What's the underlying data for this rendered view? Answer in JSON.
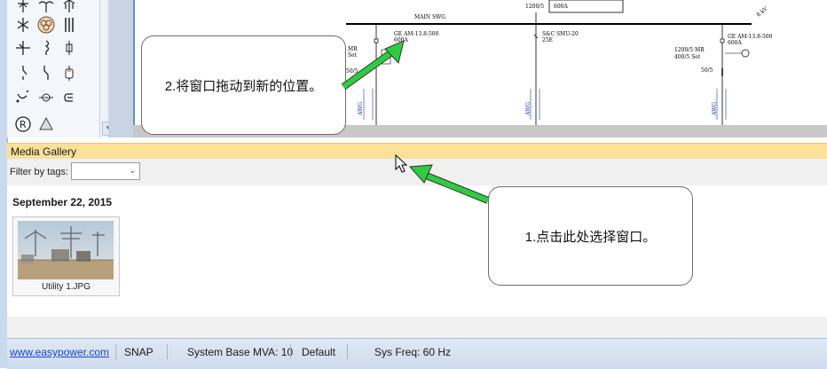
{
  "palette": {
    "symbols": [
      "generator-symbol",
      "motor-symbol",
      "bus-symbol",
      "breaker-symbol",
      "fuse-symbol",
      "relay-symbol",
      "switch-symbol",
      "cable-symbol",
      "capacitor-symbol",
      "transformer-symbol",
      "meter-symbol",
      "load-symbol",
      "r-symbol",
      "triangle-symbol"
    ],
    "r_label": "R"
  },
  "diagram": {
    "bus_label": "MAIN SWG",
    "ct_top": "1200/5",
    "top_rating": "600A",
    "left_breaker": "GE AM-13.8-500",
    "left_rating": "600A",
    "left_relay_1": "MR",
    "left_relay_2": "Set",
    "left_ct": "50/5",
    "center_breaker": "S&C SMU-20",
    "center_rating": "25E",
    "right_breaker": "GE AM-13.8-500",
    "right_rating": "600A",
    "right_relay_1": "1200/5 MR",
    "right_relay_2": "400/5 Set",
    "right_ct": "50/5",
    "corner_label": "8 kV",
    "cable_label": "AWG"
  },
  "callouts": {
    "step2": "2.将窗口拖动到新的位置。",
    "step1": "1.点击此处选择窗口。"
  },
  "media_gallery": {
    "title": "Media Gallery",
    "filter_label": "Filter by tags:",
    "filter_value": "",
    "date": "September 22, 2015",
    "items": [
      {
        "caption": "Utility 1.JPG"
      }
    ]
  },
  "status_bar": {
    "link": "www.easypower.com",
    "snap": "SNAP",
    "mva": "System Base MVA: 10",
    "mode": "Default",
    "freq": "Sys Freq: 60 Hz"
  },
  "colors": {
    "arrow": "#2ecc40",
    "header": "#fbe09a",
    "diagram_text_blue": "#1e3ca0"
  }
}
